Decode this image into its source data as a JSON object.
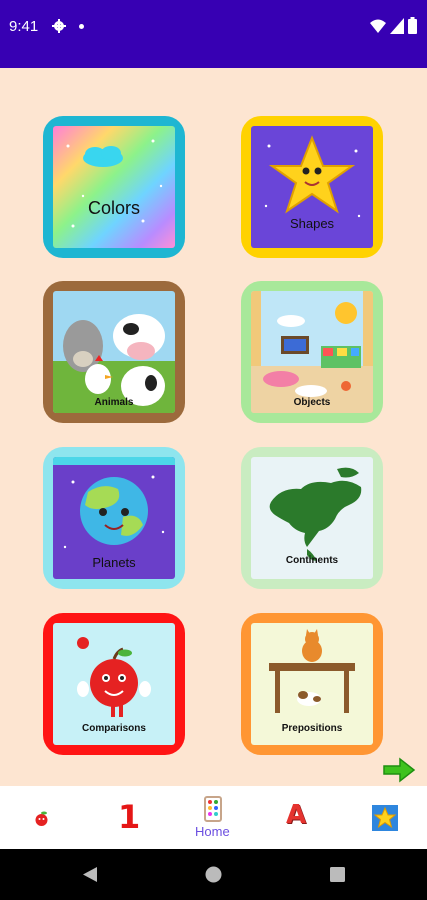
{
  "status_bar": {
    "time": "9:41",
    "background": "#3700b3"
  },
  "tiles": [
    {
      "label": "Colors",
      "border": "#1eb6d2"
    },
    {
      "label": "Shapes",
      "border": "#ffd200"
    },
    {
      "label": "Animals",
      "border": "#9c6a3c"
    },
    {
      "label": "Objects",
      "border": "#a8e89a"
    },
    {
      "label": "Planets",
      "border": "#8ee5ee"
    },
    {
      "label": "Continents",
      "border": "#c9ecc1"
    },
    {
      "label": "Comparisons",
      "border": "#ff1414"
    },
    {
      "label": "Prepositions",
      "border": "#ff9633"
    }
  ],
  "bottom_nav": {
    "items": [
      {
        "icon": "apple-icon"
      },
      {
        "label": "1",
        "icon": "number-one-icon"
      },
      {
        "label": "Home",
        "icon": "home-abacus-icon",
        "selected": true
      },
      {
        "label": "A",
        "icon": "letter-a-icon"
      },
      {
        "icon": "star-icon"
      }
    ]
  },
  "colors": {
    "background": "#fde5d1",
    "accent": "#6b4ee0"
  }
}
